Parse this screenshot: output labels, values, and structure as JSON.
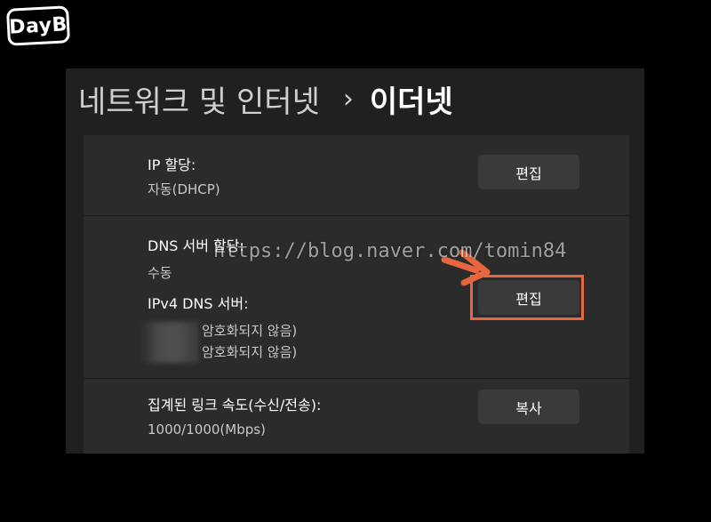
{
  "logo": {
    "text": "DayB"
  },
  "header": {
    "parent": "네트워크 및 인터넷",
    "separator": "›",
    "current": "이더넷"
  },
  "ip_assignment": {
    "label": "IP 할당:",
    "value": "자동(DHCP)",
    "button": "편집"
  },
  "dns": {
    "label": "DNS 서버 할당:",
    "value": "수동",
    "ipv4_label": "IPv4 DNS 서버:",
    "servers": [
      "암호화되지 않음)",
      "암호화되지 않음)"
    ],
    "button": "편집"
  },
  "link_speed": {
    "label": "집계된 링크 속도(수신/전송):",
    "value": "1000/1000(Mbps)",
    "button": "복사"
  },
  "watermark": "https://blog.naver.com/tomin84",
  "colors": {
    "highlight": "#e8663d",
    "panel": "#2b2b2b",
    "window": "#202020"
  }
}
